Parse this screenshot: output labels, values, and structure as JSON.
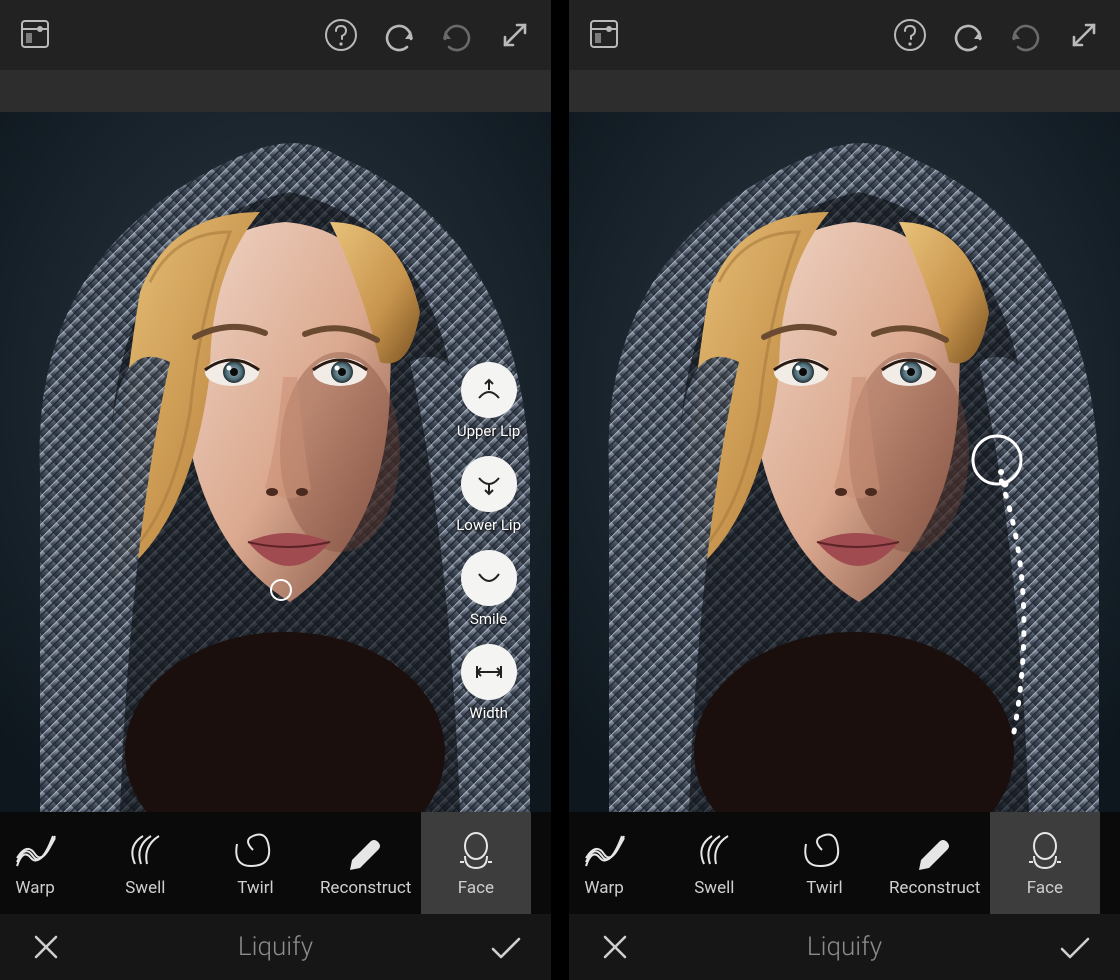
{
  "screen_title": "Liquify",
  "toolbar_icons": {
    "compare": "compare-icon",
    "help": "help-icon",
    "undo": "undo-icon",
    "redo": "redo-icon",
    "expand": "expand-icon"
  },
  "tools": [
    {
      "id": "warp",
      "label": "Warp",
      "selected": false
    },
    {
      "id": "swell",
      "label": "Swell",
      "selected": false
    },
    {
      "id": "twirl",
      "label": "Twirl",
      "selected": false
    },
    {
      "id": "reconstruct",
      "label": "Reconstruct",
      "selected": false
    },
    {
      "id": "face",
      "label": "Face",
      "selected": true
    }
  ],
  "face_flyout": [
    {
      "id": "upper_lip",
      "label": "Upper Lip",
      "icon": "upper-lip-icon"
    },
    {
      "id": "lower_lip",
      "label": "Lower Lip",
      "icon": "lower-lip-icon"
    },
    {
      "id": "smile",
      "label": "Smile",
      "icon": "smile-icon"
    },
    {
      "id": "width",
      "label": "Width",
      "icon": "width-icon"
    }
  ],
  "bottom_bar": {
    "cancel": "Cancel",
    "confirm": "Confirm"
  },
  "left_pane": {
    "shows_face_flyout": true,
    "mouth_marker": true
  },
  "right_pane": {
    "shows_face_flyout": false,
    "gesture_trail": true
  },
  "colors": {
    "toolbar": "#222222",
    "tool_row": "#0a0a0a",
    "bottom_bar": "#161616",
    "selected": "#3d3d3d",
    "icon": "#b9b9b9",
    "title": "#8c8c8c"
  }
}
